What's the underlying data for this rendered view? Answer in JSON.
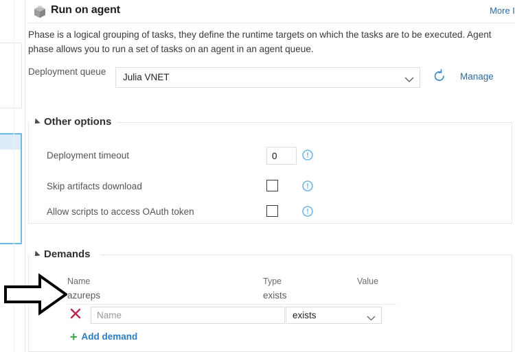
{
  "panel": {
    "icon": "cube-icon",
    "title": "Run on agent",
    "more_info_label": "More Info",
    "description": "Phase is a logical grouping of tasks, they define the runtime targets on which the tasks are to be executed. Agent\nphase allows you to run a set of tasks on an agent in an agent queue."
  },
  "deployment_queue": {
    "label": "Deployment\nqueue",
    "selected_value": "Julia VNET",
    "chevron_icon": "chevron-down-icon",
    "refresh_icon": "refresh-icon",
    "manage_label": "Manage"
  },
  "other_options": {
    "legend": "Other options",
    "caret_icon": "caret-expanded-icon",
    "rows": [
      {
        "label": "Deployment timeout",
        "control": "textbox",
        "value": "0",
        "info_icon": "info-icon"
      },
      {
        "label": "Skip artifacts download",
        "control": "checkbox",
        "checked": false,
        "info_icon": "info-icon"
      },
      {
        "label": "Allow scripts to access OAuth token",
        "control": "checkbox",
        "checked": false,
        "info_icon": "info-icon"
      }
    ]
  },
  "demands": {
    "legend": "Demands",
    "caret_icon": "caret-expanded-icon",
    "columns": [
      "Name",
      "Type",
      "Value"
    ],
    "rows": [
      {
        "name": "azureps",
        "type": "exists",
        "value": ""
      }
    ],
    "new_row": {
      "delete_icon": "delete-x-icon",
      "name_placeholder": "Name",
      "name_value": "",
      "type_value": "exists",
      "type_chevron_icon": "chevron-down-icon",
      "value_value": ""
    },
    "add_demand_label": "Add demand",
    "add_demand_icon": "plus-icon"
  },
  "annotation": {
    "arrow_icon": "right-arrow-annotation"
  },
  "colors": {
    "link": "#2b6ca3",
    "add_link": "#2b7cc4",
    "plus_green": "#3ba64b",
    "delete_red": "#b5294a",
    "info_blue": "#6cb8e6",
    "selected_card_border": "#6cb8e6"
  }
}
